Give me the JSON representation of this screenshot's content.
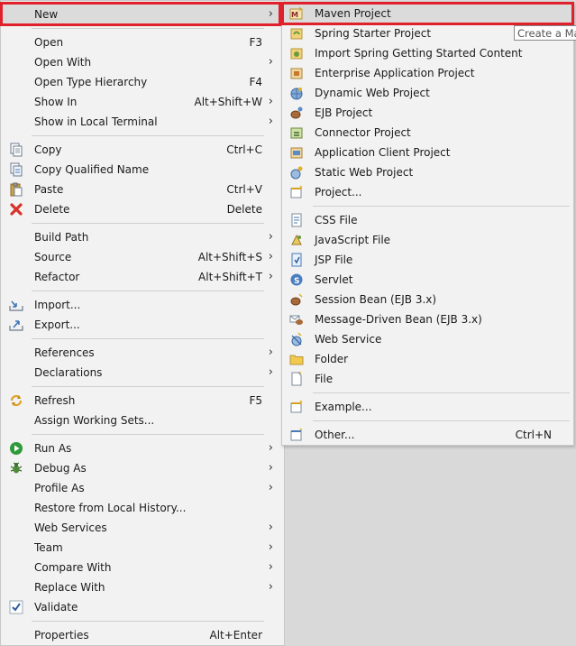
{
  "left_menu": {
    "new": "New",
    "open": "Open",
    "open_accel": "F3",
    "open_with": "Open With",
    "open_type_hierarchy": "Open Type Hierarchy",
    "open_type_hierarchy_accel": "F4",
    "show_in": "Show In",
    "show_in_accel": "Alt+Shift+W",
    "show_in_local_terminal": "Show in Local Terminal",
    "copy": "Copy",
    "copy_accel": "Ctrl+C",
    "copy_qualified_name": "Copy Qualified Name",
    "paste": "Paste",
    "paste_accel": "Ctrl+V",
    "delete": "Delete",
    "delete_accel": "Delete",
    "build_path": "Build Path",
    "source": "Source",
    "source_accel": "Alt+Shift+S",
    "refactor": "Refactor",
    "refactor_accel": "Alt+Shift+T",
    "import": "Import...",
    "export": "Export...",
    "references": "References",
    "declarations": "Declarations",
    "refresh": "Refresh",
    "refresh_accel": "F5",
    "assign_working_sets": "Assign Working Sets...",
    "run_as": "Run As",
    "debug_as": "Debug As",
    "profile_as": "Profile As",
    "restore_from_local_history": "Restore from Local History...",
    "web_services": "Web Services",
    "team": "Team",
    "compare_with": "Compare With",
    "replace_with": "Replace With",
    "validate": "Validate",
    "properties": "Properties",
    "properties_accel": "Alt+Enter"
  },
  "submenu": {
    "maven_project": "Maven Project",
    "spring_starter_project": "Spring Starter Project",
    "import_spring_getting_started": "Import Spring Getting Started Content",
    "enterprise_application_project": "Enterprise Application Project",
    "dynamic_web_project": "Dynamic Web Project",
    "ejb_project": "EJB Project",
    "connector_project": "Connector Project",
    "application_client_project": "Application Client Project",
    "static_web_project": "Static Web Project",
    "project": "Project...",
    "css_file": "CSS File",
    "javascript_file": "JavaScript File",
    "jsp_file": "JSP File",
    "servlet": "Servlet",
    "session_bean": "Session Bean (EJB 3.x)",
    "message_driven_bean": "Message-Driven Bean (EJB 3.x)",
    "web_service": "Web Service",
    "folder": "Folder",
    "file": "File",
    "example": "Example...",
    "other": "Other...",
    "other_accel": "Ctrl+N"
  },
  "tooltip": "Create a Ma",
  "colors": {
    "highlight_box": "#e0202a",
    "menu_bg": "#f2f2f2"
  }
}
